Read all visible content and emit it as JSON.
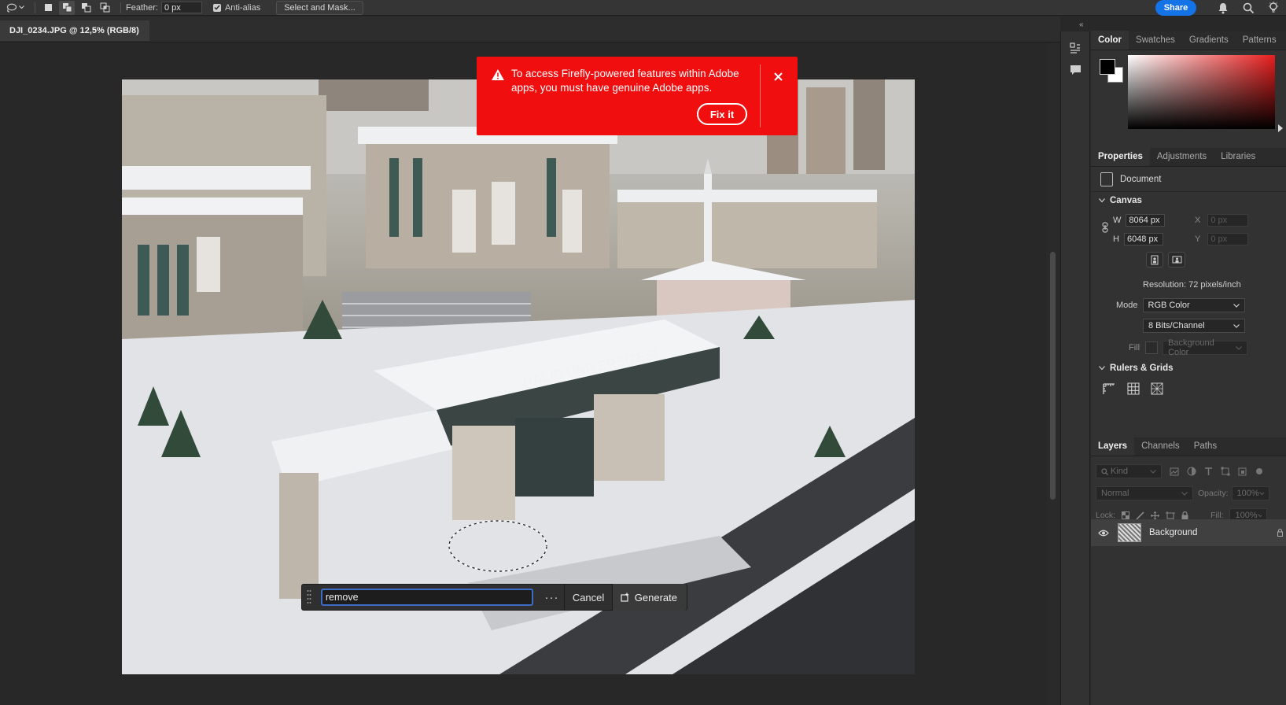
{
  "options_bar": {
    "feather_label": "Feather:",
    "feather_value": "0 px",
    "antialias_label": "Anti-alias",
    "select_mask_label": "Select and Mask...",
    "share_label": "Share"
  },
  "document": {
    "tab_title": "DJI_0234.JPG @ 12,5% (RGB/8)"
  },
  "alert": {
    "message": "To access Firefly-powered features within Adobe apps, you must have genuine Adobe apps.",
    "fix_label": "Fix it",
    "bg_color": "#f00e0e"
  },
  "generate_bar": {
    "prompt_value": "remove",
    "more_label": "···",
    "cancel_label": "Cancel",
    "generate_label": "Generate"
  },
  "color_panel": {
    "tabs": [
      "Color",
      "Swatches",
      "Gradients",
      "Patterns"
    ],
    "foreground": "#000000",
    "background": "#ffffff"
  },
  "properties_panel": {
    "tabs": [
      "Properties",
      "Adjustments",
      "Libraries"
    ],
    "document_label": "Document",
    "canvas_header": "Canvas",
    "w_label": "W",
    "w_value": "8064 px",
    "h_label": "H",
    "h_value": "6048 px",
    "x_label": "X",
    "x_value": "0 px",
    "y_label": "Y",
    "y_value": "0 px",
    "resolution": "Resolution: 72 pixels/inch",
    "mode_label": "Mode",
    "mode_value": "RGB Color",
    "bits_value": "8 Bits/Channel",
    "fill_label": "Fill",
    "fill_value": "Background Color",
    "rulers_header": "Rulers & Grids"
  },
  "layers_panel": {
    "tabs": [
      "Layers",
      "Channels",
      "Paths"
    ],
    "kind_placeholder": "Kind",
    "blend_mode": "Normal",
    "opacity_label": "Opacity:",
    "opacity_value": "100%",
    "lock_label": "Lock:",
    "fill_label": "Fill:",
    "fill_value": "100%",
    "layer_name": "Background"
  }
}
